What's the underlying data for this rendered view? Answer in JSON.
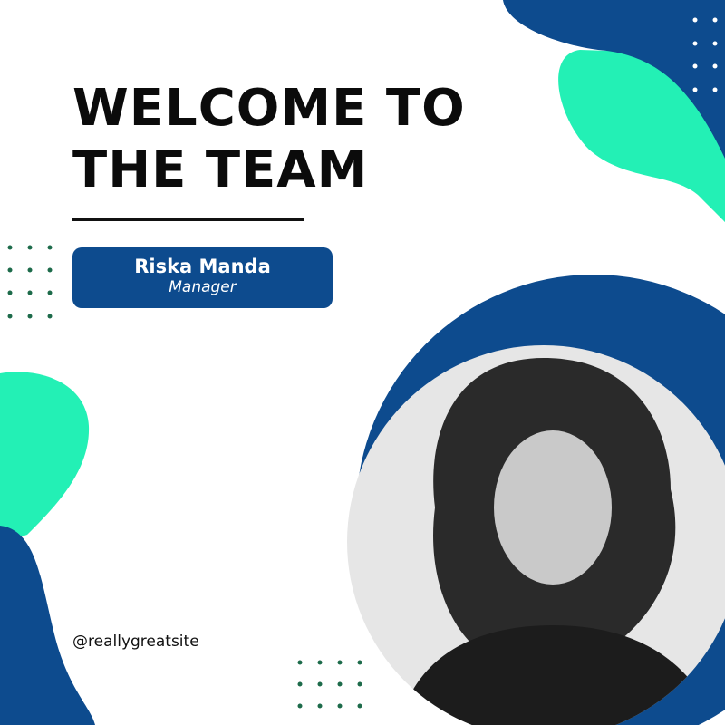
{
  "title_lines": [
    "WELCOME TO",
    "THE TEAM"
  ],
  "member": {
    "name": "Riska Manda",
    "role": "Manager"
  },
  "handle": "@reallygreatsite",
  "colors": {
    "blue": "#0d4b8e",
    "green": "#23f0b5",
    "dots_green": "#1d6b4a",
    "text": "#0b0b0b"
  }
}
